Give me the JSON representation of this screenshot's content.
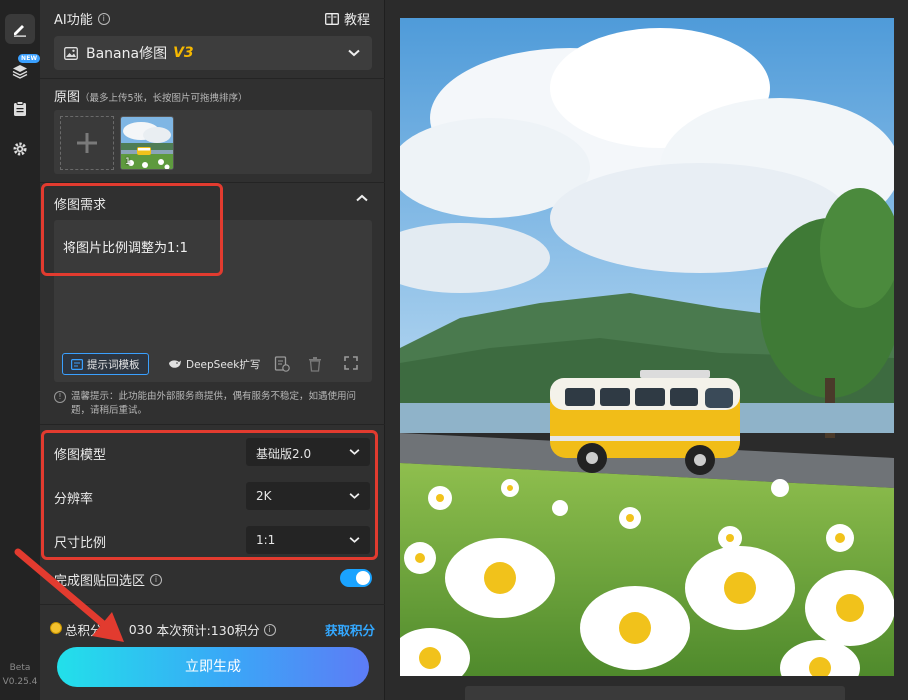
{
  "rail": {
    "new_badge": "NEW",
    "beta_label": "Beta",
    "version": "V0.25.4"
  },
  "panel": {
    "title": "AI功能",
    "tutorial_label": "教程",
    "function_select": {
      "value": "Banana修图",
      "tag": "V3"
    },
    "original": {
      "title": "原图",
      "hint": "（最多上传5张，长按图片可拖拽排序）",
      "thumb_index": "1"
    },
    "requirement": {
      "title": "修图需求",
      "text": "将图片比例调整为1:1",
      "prompt_template_label": "提示词模板",
      "deepseek_label": "DeepSeek扩写"
    },
    "tip": "温馨提示：此功能由外部服务商提供，偶有服务不稳定，如遇使用问题，请稍后重试。",
    "params": [
      {
        "label": "修图模型",
        "value": "基础版2.0"
      },
      {
        "label": "分辨率",
        "value": "2K"
      },
      {
        "label": "尺寸比例",
        "value": "1:1"
      }
    ],
    "paste_back": {
      "label": "完成图贴回选区",
      "enabled": true
    },
    "points": {
      "total_label": "总积分",
      "total_value": "030",
      "estimate": "本次预计:130积分",
      "get_points": "获取积分"
    },
    "generate_label": "立即生成"
  },
  "colors": {
    "accent": "#3aa0ff",
    "highlight": "#e23b2f",
    "v3": "#f5b800"
  }
}
